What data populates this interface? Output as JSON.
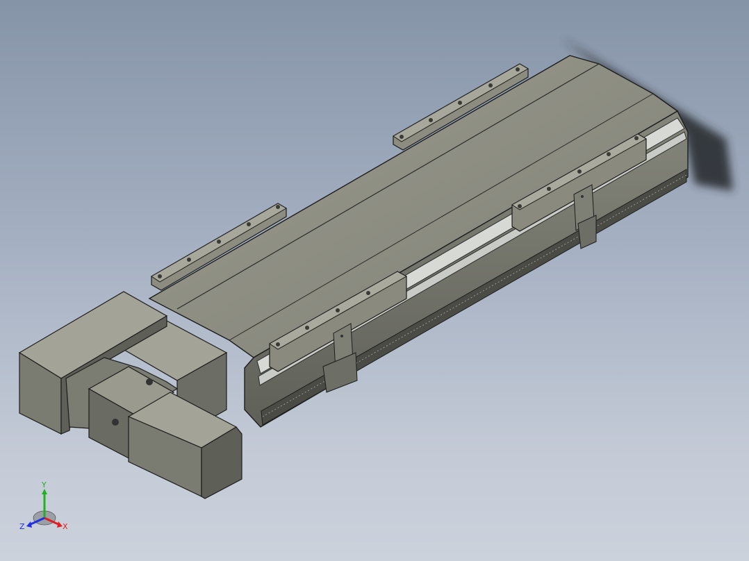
{
  "viewport": {
    "background_top": "#8694a8",
    "background_bottom": "#ccd2dc"
  },
  "model": {
    "body_color": "#8c8c80",
    "body_light": "#a3a397",
    "body_dark": "#5e5f57",
    "rail_color": "#d6d8d4"
  },
  "triad": {
    "x_label": "X",
    "y_label": "Y",
    "z_label": "Z",
    "x_color": "#e02020",
    "y_color": "#20b020",
    "z_color": "#2030e0"
  }
}
